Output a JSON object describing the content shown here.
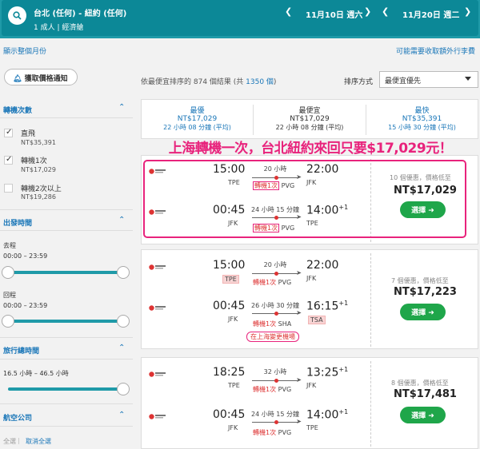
{
  "header": {
    "route": "台北 (任何) - 紐約 (任何)",
    "pax": "1 成人 | 經濟艙",
    "depart": {
      "prev": "❮",
      "date": "11月10日 週六",
      "next": "❯"
    },
    "return": {
      "prev": "❮",
      "date": "11月20日 週二",
      "next": "❯"
    }
  },
  "links": {
    "full_month": "顯示整個月份",
    "fees": "可能需要收取額外行李費"
  },
  "alert_button": "獲取價格通知",
  "sidebar": {
    "stops": {
      "title": "轉機次數",
      "items": [
        {
          "label": "直飛",
          "price": "NT$35,391",
          "checked": true
        },
        {
          "label": "轉機1次",
          "price": "NT$17,029",
          "checked": true
        },
        {
          "label": "轉機2次以上",
          "price": "NT$19,286",
          "checked": false
        }
      ]
    },
    "times": {
      "title": "出發時間",
      "outbound_label": "去程",
      "outbound_range": "00:00 – 23:59",
      "return_label": "回程",
      "return_range": "00:00 – 23:59"
    },
    "duration": {
      "title": "旅行總時間",
      "range": "16.5 小時 – 46.5 小時"
    },
    "airlines": {
      "title": "航空公司",
      "select_all": "全選",
      "clear_all": "取消全選"
    }
  },
  "results": {
    "prefix": "依最便宜排序的 874 個結果 (共",
    "total": "1350 個",
    "suffix": ")"
  },
  "sort": {
    "label": "排序方式",
    "value": "最便宜優先"
  },
  "tabs": [
    {
      "label": "最優",
      "price": "NT$17,029",
      "dur": "22 小時 08 分鐘 (平均)"
    },
    {
      "label": "最便宜",
      "price": "NT$17,029",
      "dur": "22 小時 08 分鐘 (平均)"
    },
    {
      "label": "最快",
      "price": "NT$35,391",
      "dur": "15 小時 30 分鐘 (平均)"
    }
  ],
  "callout": "上海轉機一次，台北紐約來回只要$17,029元！",
  "flights": [
    {
      "out": {
        "dep": "15:00",
        "from": "TPE",
        "dur": "20 小時",
        "arr": "22:00",
        "to": "JFK",
        "stop_label": "轉機1次",
        "stop_code": "PVG"
      },
      "ret": {
        "dep": "00:45",
        "from": "JFK",
        "dur": "24 小時 15 分鐘",
        "arr": "14:00",
        "plus": "+1",
        "to": "TPE",
        "stop_label": "轉機1次",
        "stop_code": "PVG"
      },
      "seats": "10 個優惠，價格低至",
      "price": "NT$17,029",
      "cta": "選擇 ➜"
    },
    {
      "out": {
        "dep": "15:00",
        "from": "TPE",
        "dur": "20 小時",
        "arr": "22:00",
        "to": "JFK",
        "stop_label": "轉機1次",
        "stop_code": "PVG"
      },
      "ret": {
        "dep": "00:45",
        "from": "JFK",
        "dur": "26 小時 30 分鐘",
        "arr": "16:15",
        "plus": "+1",
        "to": "TSA",
        "stop_label": "轉機1次",
        "stop_code": "SHA",
        "warning": "在上海變更機場"
      },
      "seats": "7 個優惠，價格低至",
      "price": "NT$17,223",
      "cta": "選擇 ➜"
    },
    {
      "out": {
        "dep": "18:25",
        "from": "TPE",
        "dur": "32 小時",
        "arr": "13:25",
        "plus": "+1",
        "to": "JFK",
        "stop_label": "轉機1次",
        "stop_code": "PVG"
      },
      "ret": {
        "dep": "00:45",
        "from": "JFK",
        "dur": "24 小時 15 分鐘",
        "arr": "14:00",
        "plus": "+1",
        "to": "TPE",
        "stop_label": "轉機1次",
        "stop_code": "PVG"
      },
      "seats": "8 個優惠，價格低至",
      "price": "NT$17,481",
      "cta": "選擇 ➜"
    }
  ],
  "colors": {
    "header": "#0c8897",
    "accent": "#1976b8",
    "cta": "#1fa64a",
    "highlight": "#e8237c"
  },
  "icons": {
    "search": "search-icon",
    "bell": "bell-icon",
    "airline": "china-eastern-logo-icon"
  }
}
